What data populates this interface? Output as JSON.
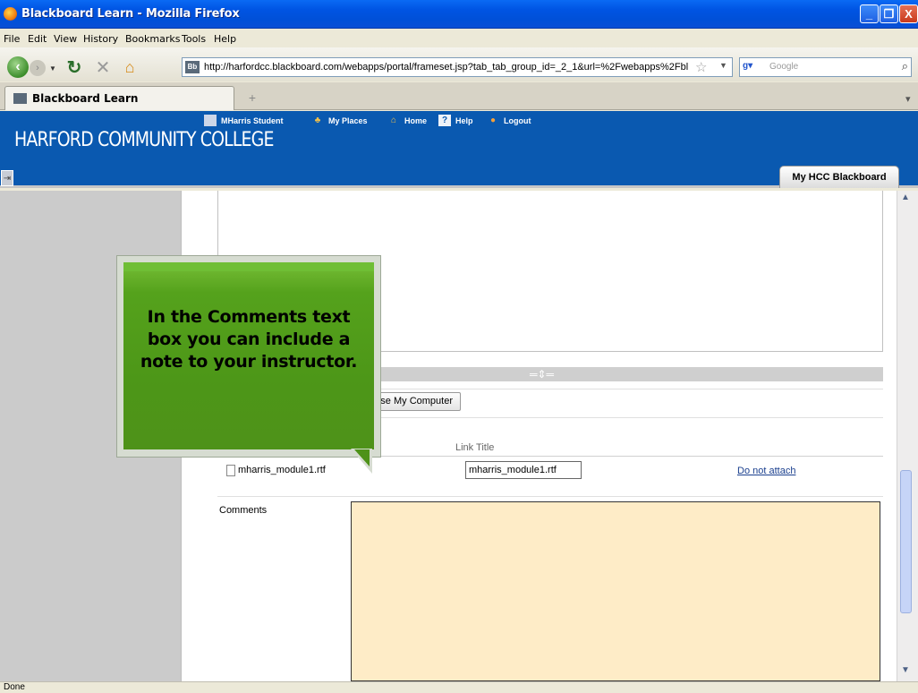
{
  "window": {
    "title": "Blackboard Learn - Mozilla Firefox",
    "minimize": "_",
    "maximize": "❐",
    "close": "X"
  },
  "menu": [
    "File",
    "Edit",
    "View",
    "History",
    "Bookmarks",
    "Tools",
    "Help"
  ],
  "nav": {
    "url": "http://harfordcc.blackboard.com/webapps/portal/frameset.jsp?tab_tab_group_id=_2_1&url=%2Fwebapps%2Fbl",
    "search_placeholder": "Google",
    "site_icon": "Bb"
  },
  "tabs": [
    {
      "label": "Blackboard Learn"
    }
  ],
  "blackboard": {
    "logo": "HARFORD COMMUNITY COLLEGE",
    "user": "MHarris Student",
    "my_places": "My Places",
    "home": "Home",
    "help": "Help",
    "logout": "Logout",
    "active_tab": "My HCC Blackboard"
  },
  "form": {
    "browse_label": "se My Computer",
    "link_title_header": "Link Title",
    "file_name": "mharris_module1.rtf",
    "link_title_value": "mharris_module1.rtf",
    "do_not_attach": "Do not attach",
    "comments_label": "Comments"
  },
  "callout": {
    "text": "In the Comments text box you can include a note to your instructor."
  },
  "status": {
    "text": "Done"
  },
  "colors": {
    "bb_header": "#0a59b0",
    "callout_green": "#4e9219",
    "comments_bg": "#feecc7"
  }
}
